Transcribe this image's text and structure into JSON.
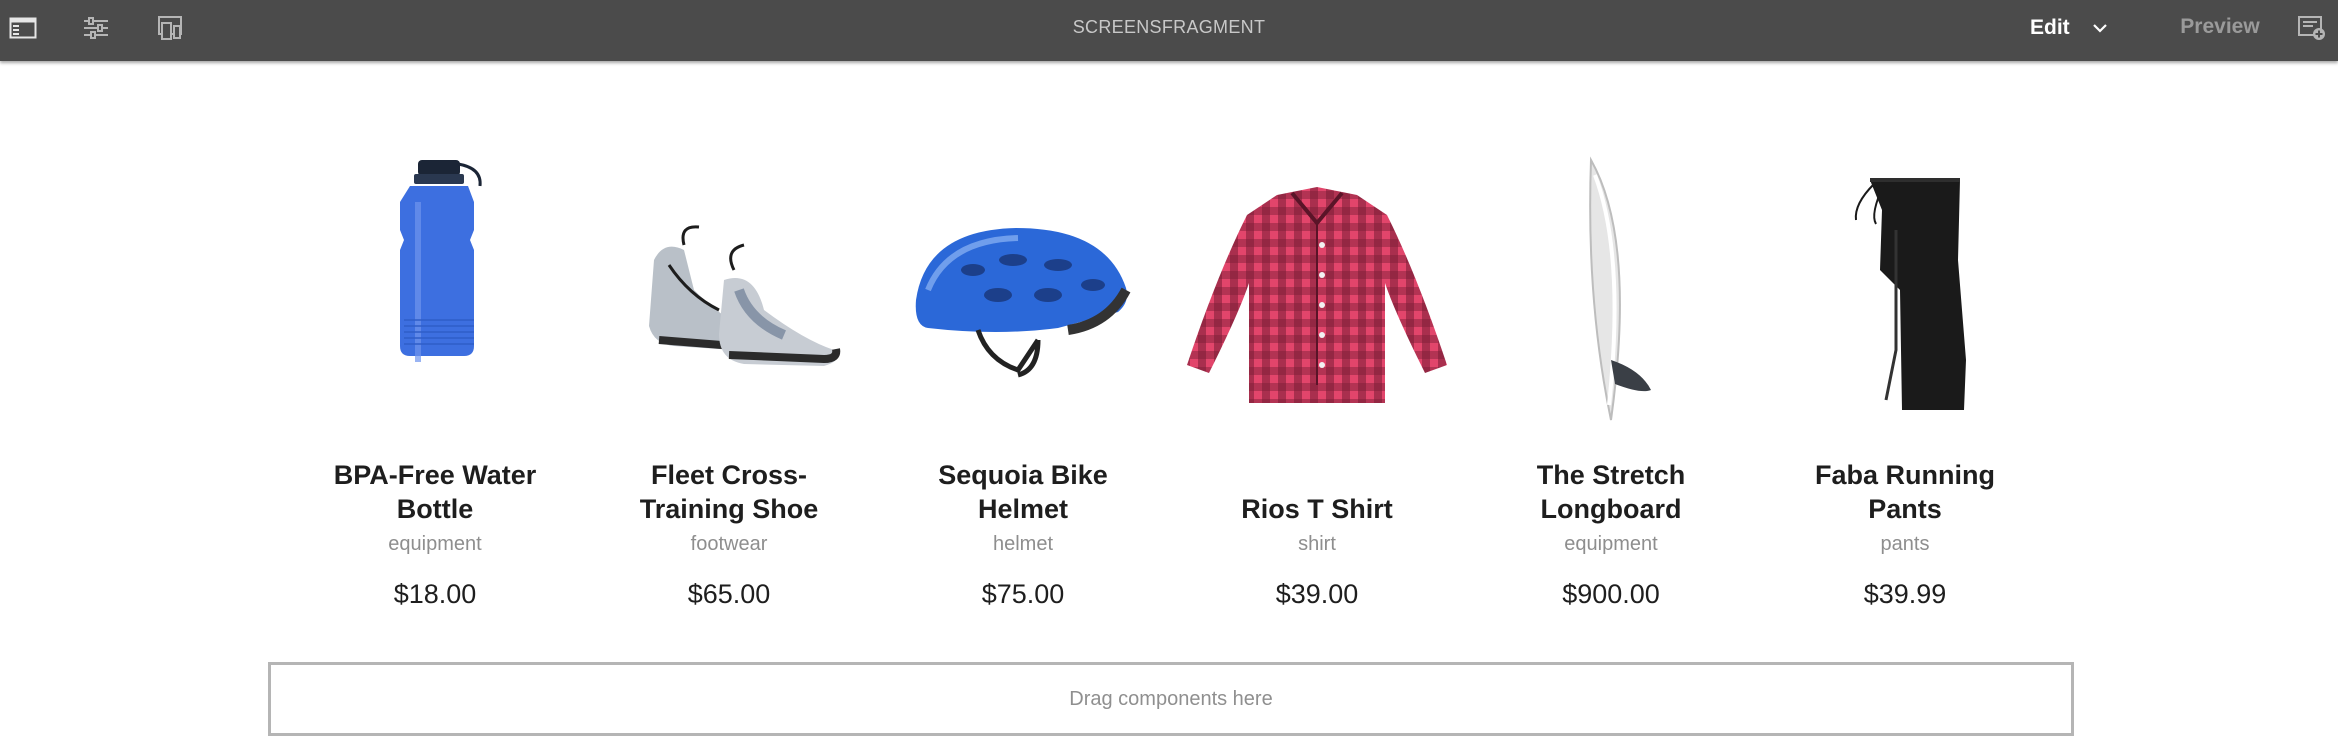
{
  "toolbar": {
    "title": "SCREENSFRAGMENT",
    "mode_label": "Edit",
    "preview_label": "Preview",
    "icons": [
      "side-panel-icon",
      "page-properties-icon",
      "emulator-icon",
      "annotations-icon",
      "chevron-down-icon"
    ]
  },
  "products": [
    {
      "name": "BPA-Free Water Bottle",
      "category": "equipment",
      "price": "$18.00",
      "image": "water-bottle",
      "color": "#3d6fe0"
    },
    {
      "name": "Fleet Cross-Training Shoe",
      "category": "footwear",
      "price": "$65.00",
      "image": "shoe",
      "color": "#9aa3ad"
    },
    {
      "name": "Sequoia Bike Helmet",
      "category": "helmet",
      "price": "$75.00",
      "image": "bike-helmet",
      "color": "#2b68d8"
    },
    {
      "name": "Rios T Shirt",
      "category": "shirt",
      "price": "$39.00",
      "image": "plaid-shirt",
      "color": "#e2456b"
    },
    {
      "name": "The Stretch Longboard",
      "category": "equipment",
      "price": "$900.00",
      "image": "surfboard",
      "color": "#e8e8e8"
    },
    {
      "name": "Faba Running Pants",
      "category": "pants",
      "price": "$39.99",
      "image": "pants",
      "color": "#1a1a1a"
    }
  ],
  "dropzone": {
    "label": "Drag components here"
  }
}
